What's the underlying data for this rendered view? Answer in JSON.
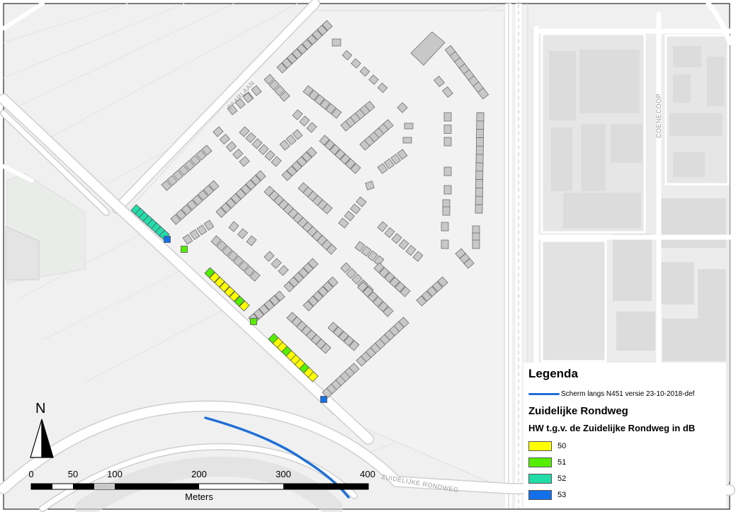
{
  "map": {
    "street_labels": {
      "paarlaan": "PAARLAAN",
      "coenecoop": "COENECOOP",
      "zuidelijke_rondweg": "ZUIDELIJKE RONDWEG"
    }
  },
  "north_arrow": {
    "letter": "N"
  },
  "scalebar": {
    "ticks": [
      "0",
      "50",
      "100",
      "200",
      "300",
      "400"
    ],
    "units": "Meters"
  },
  "legend": {
    "title": "Legenda",
    "screen": {
      "label": "Scherm langs N451 versie 23-10-2018-def",
      "color": "#1f6fd6"
    },
    "layer_title": "Zuidelijke Rondweg",
    "field_title": "HW t.g.v. de Zuidelijke Rondweg in dB",
    "classes": [
      {
        "label": "50",
        "color": "#ffff00"
      },
      {
        "label": "51",
        "color": "#55ee00"
      },
      {
        "label": "52",
        "color": "#22ddaa"
      },
      {
        "label": "53",
        "color": "#1470e8"
      }
    ]
  },
  "colors": {
    "land": "#f0f0f0",
    "road_fill": "#ffffff",
    "road_edge": "#cfcfcf",
    "building": "#c8c8c8",
    "building_stroke": "#6e6e6e",
    "rail": "#b8b8b8"
  }
}
